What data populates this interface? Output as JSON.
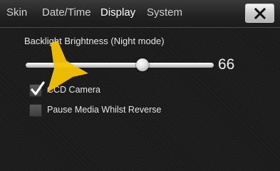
{
  "tabs": [
    {
      "label": "Skin",
      "active": false
    },
    {
      "label": "Date/Time",
      "active": false
    },
    {
      "label": "Display",
      "active": true
    },
    {
      "label": "System",
      "active": false
    }
  ],
  "close_icon": "close-x-icon",
  "backlight": {
    "label": "Backlight Brightness (Night mode)",
    "value": "66",
    "level_fraction": 0.62
  },
  "options": [
    {
      "label": "CCD Camera",
      "checked": true
    },
    {
      "label": "Pause Media Whilst Reverse",
      "checked": false
    }
  ],
  "annotation": {
    "icon": "arrow-pointer-icon",
    "color": "#f5c400"
  },
  "colors": {
    "accent": "#f5c400",
    "background": "#1a1a1a",
    "text": "#e6e6e6"
  }
}
